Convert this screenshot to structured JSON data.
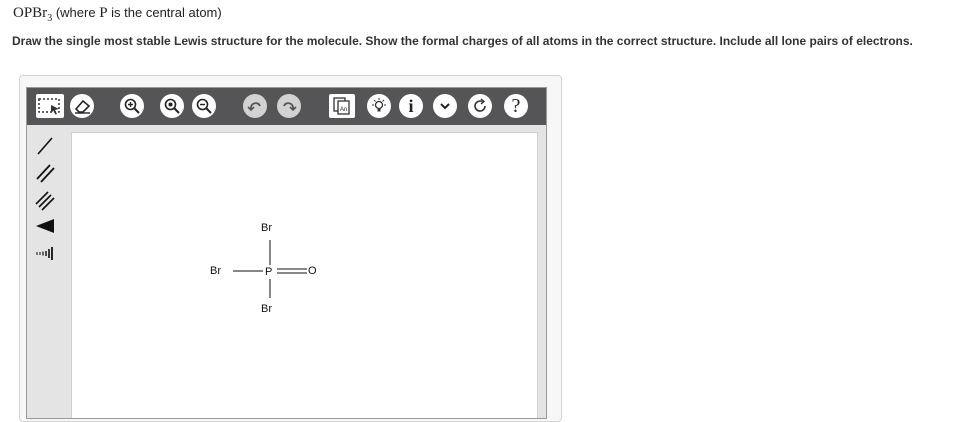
{
  "question": {
    "formula_main": "OPBr",
    "formula_sub": "3",
    "formula_note": "(where",
    "formula_atom": "P",
    "formula_note_end": "is the central atom)",
    "instructions": "Draw the single most stable Lewis structure for the molecule. Show the formal charges of all atoms in the correct structure. Include all lone pairs of electrons."
  },
  "toolbar": {
    "icons": [
      "select-icon",
      "eraser-icon",
      "zoom-in-icon",
      "zoom-fit-icon",
      "zoom-out-icon",
      "undo-icon",
      "redo-icon",
      "templates-icon",
      "bulb-icon",
      "info-icon",
      "chevron-down-icon",
      "refresh-icon",
      "help-icon"
    ],
    "help_label": "?",
    "info_label": "i"
  },
  "side_tools": [
    "single-bond-icon",
    "double-bond-icon",
    "triple-bond-icon",
    "wedge-bond-icon",
    "hash-bond-icon"
  ],
  "molecule": {
    "atoms": {
      "top": "Br",
      "left": "Br",
      "center": "P",
      "right": "O",
      "bottom": "Br"
    }
  },
  "colors": {
    "toolbar_bg": "#555558",
    "canvas_bg": "#ffffff",
    "panel_bg": "#e4e4e4"
  }
}
